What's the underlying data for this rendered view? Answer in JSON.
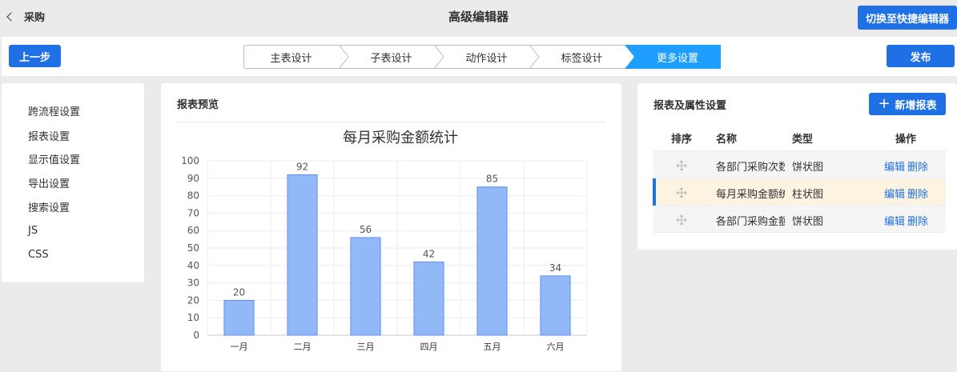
{
  "header": {
    "back_label": "采购",
    "title": "高级编辑器",
    "switch_label": "切换至快捷编辑器"
  },
  "stepbar": {
    "prev_label": "上一步",
    "publish_label": "发布",
    "steps": [
      {
        "label": "主表设计",
        "active": false
      },
      {
        "label": "子表设计",
        "active": false
      },
      {
        "label": "动作设计",
        "active": false
      },
      {
        "label": "标签设计",
        "active": false
      },
      {
        "label": "更多设置",
        "active": true
      }
    ]
  },
  "sidebar": {
    "items": [
      {
        "label": "跨流程设置",
        "active": false
      },
      {
        "label": "报表设置",
        "active": true
      },
      {
        "label": "显示值设置",
        "active": false
      },
      {
        "label": "导出设置",
        "active": false
      },
      {
        "label": "搜索设置",
        "active": false
      },
      {
        "label": "JS",
        "active": false
      },
      {
        "label": "CSS",
        "active": false
      }
    ]
  },
  "preview": {
    "title": "报表预览"
  },
  "chart_data": {
    "type": "bar",
    "title": "每月采购金额统计",
    "categories": [
      "一月",
      "二月",
      "三月",
      "四月",
      "五月",
      "六月"
    ],
    "values": [
      20,
      92,
      56,
      42,
      85,
      34
    ],
    "ylim": [
      0,
      100
    ],
    "yticks": [
      0,
      10,
      20,
      30,
      40,
      50,
      60,
      70,
      80,
      90,
      100
    ],
    "xlabel": "",
    "ylabel": "",
    "grid": true,
    "bar_color": "#92b8f8",
    "bar_border": "#5b93f0"
  },
  "reports": {
    "title": "报表及属性设置",
    "add_label": "新增报表",
    "columns": {
      "order": "排序",
      "name": "名称",
      "type": "类型",
      "ops": "操作"
    },
    "rows": [
      {
        "name": "各部门采购次数",
        "type": "饼状图",
        "edit": "编辑",
        "delete": "删除",
        "highlight": false
      },
      {
        "name": "每月采购金额统计",
        "type": "柱状图",
        "edit": "编辑",
        "delete": "删除",
        "highlight": true
      },
      {
        "name": "各部门采购金额",
        "type": "饼状图",
        "edit": "编辑",
        "delete": "删除",
        "highlight": false
      }
    ]
  },
  "colors": {
    "accent": "#1f6fe5",
    "step_active": "#1e9fff"
  }
}
